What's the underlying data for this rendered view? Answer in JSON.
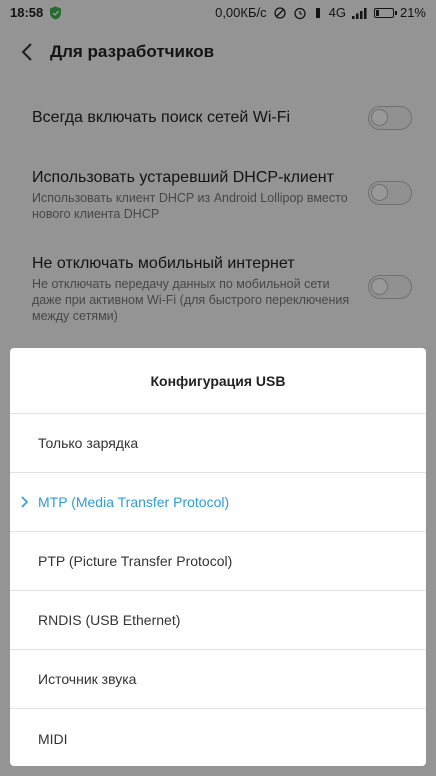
{
  "status_bar": {
    "time": "18:58",
    "net_speed": "0,00КБ/с",
    "network_type": "4G",
    "battery_percent": "21%",
    "battery_level": 0.21,
    "icons": [
      "shield-icon",
      "alarm-icon",
      "mute-icon",
      "signal-icon",
      "battery-icon"
    ]
  },
  "header": {
    "title": "Для разработчиков"
  },
  "settings": [
    {
      "title": "Всегда включать поиск сетей Wi-Fi",
      "description": "",
      "enabled": false
    },
    {
      "title": "Использовать устаревший DHCP-клиент",
      "description": "Использовать клиент DHCP из Android Lollipop вместо нового клиента DHCP",
      "enabled": false
    },
    {
      "title": "Не отключать мобильный интернет",
      "description": "Не отключать передачу данных по мобильной сети даже при активном Wi-Fi (для быстрого переключения между сетями)",
      "enabled": false
    }
  ],
  "dialog": {
    "title": "Конфигурация USB",
    "options": [
      {
        "label": "Только зарядка",
        "selected": false
      },
      {
        "label": "MTP (Media Transfer Protocol)",
        "selected": true
      },
      {
        "label": "PTP (Picture Transfer Protocol)",
        "selected": false
      },
      {
        "label": "RNDIS (USB Ethernet)",
        "selected": false
      },
      {
        "label": "Источник звука",
        "selected": false
      },
      {
        "label": "MIDI",
        "selected": false
      }
    ],
    "accent_color": "#2e9cd8"
  }
}
